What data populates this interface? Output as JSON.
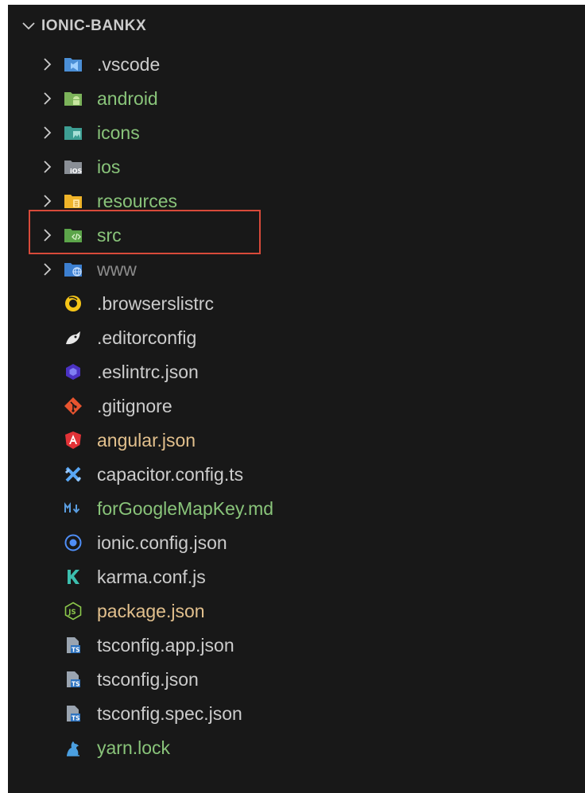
{
  "explorer": {
    "title": "IONIC-BANKX",
    "items": [
      {
        "label": ".vscode",
        "kind": "folder",
        "icon": "vscode-folder-icon",
        "color": "#cccccc"
      },
      {
        "label": "android",
        "kind": "folder",
        "icon": "android-folder-icon",
        "color": "#89c47a"
      },
      {
        "label": "icons",
        "kind": "folder",
        "icon": "images-folder-icon",
        "color": "#89c47a"
      },
      {
        "label": "ios",
        "kind": "folder",
        "icon": "ios-folder-icon",
        "color": "#89c47a"
      },
      {
        "label": "resources",
        "kind": "folder",
        "icon": "resources-folder-icon",
        "color": "#89c47a"
      },
      {
        "label": "src",
        "kind": "folder",
        "icon": "src-folder-icon",
        "color": "#89c47a",
        "highlighted": true
      },
      {
        "label": "www",
        "kind": "folder",
        "icon": "www-folder-icon",
        "color": "#8b8b8b"
      },
      {
        "label": ".browserslistrc",
        "kind": "file",
        "icon": "browserslist-icon",
        "color": "#cccccc"
      },
      {
        "label": ".editorconfig",
        "kind": "file",
        "icon": "editorconfig-icon",
        "color": "#cccccc"
      },
      {
        "label": ".eslintrc.json",
        "kind": "file",
        "icon": "eslint-icon",
        "color": "#cccccc"
      },
      {
        "label": ".gitignore",
        "kind": "file",
        "icon": "git-icon",
        "color": "#cccccc"
      },
      {
        "label": "angular.json",
        "kind": "file",
        "icon": "angular-icon",
        "color": "#e2c08d"
      },
      {
        "label": "capacitor.config.ts",
        "kind": "file",
        "icon": "capacitor-icon",
        "color": "#cccccc"
      },
      {
        "label": "forGoogleMapKey.md",
        "kind": "file",
        "icon": "markdown-icon",
        "color": "#89c47a"
      },
      {
        "label": "ionic.config.json",
        "kind": "file",
        "icon": "ionic-icon",
        "color": "#cccccc"
      },
      {
        "label": "karma.conf.js",
        "kind": "file",
        "icon": "karma-icon",
        "color": "#cccccc"
      },
      {
        "label": "package.json",
        "kind": "file",
        "icon": "nodejs-icon",
        "color": "#e2c08d"
      },
      {
        "label": "tsconfig.app.json",
        "kind": "file",
        "icon": "tsconfig-icon",
        "color": "#cccccc"
      },
      {
        "label": "tsconfig.json",
        "kind": "file",
        "icon": "tsconfig-icon",
        "color": "#cccccc"
      },
      {
        "label": "tsconfig.spec.json",
        "kind": "file",
        "icon": "tsconfig-icon",
        "color": "#cccccc"
      },
      {
        "label": "yarn.lock",
        "kind": "file",
        "icon": "yarn-icon",
        "color": "#89c47a"
      }
    ]
  }
}
